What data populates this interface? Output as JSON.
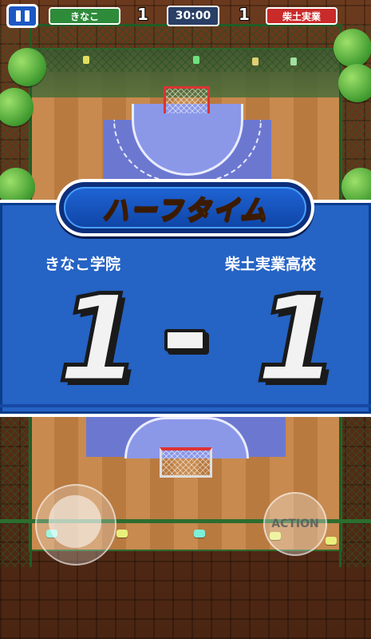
{
  "hud": {
    "home_team": "きなこ",
    "home_color": "#2e8b3a",
    "away_team": "柴土実業",
    "away_color": "#c92a2a",
    "home_score": "1",
    "away_score": "1",
    "timer": "30:00"
  },
  "overlay": {
    "title": "ハーフタイム",
    "home_school": "きなこ学院",
    "away_school": "柴土実業高校",
    "home_score": "1",
    "away_score": "1"
  },
  "controls": {
    "action_label": "ACTION"
  },
  "colors": {
    "banner_blue": "#2563c4",
    "title_yellow": "#ffd21f"
  },
  "icons": [
    "pause-icon"
  ]
}
